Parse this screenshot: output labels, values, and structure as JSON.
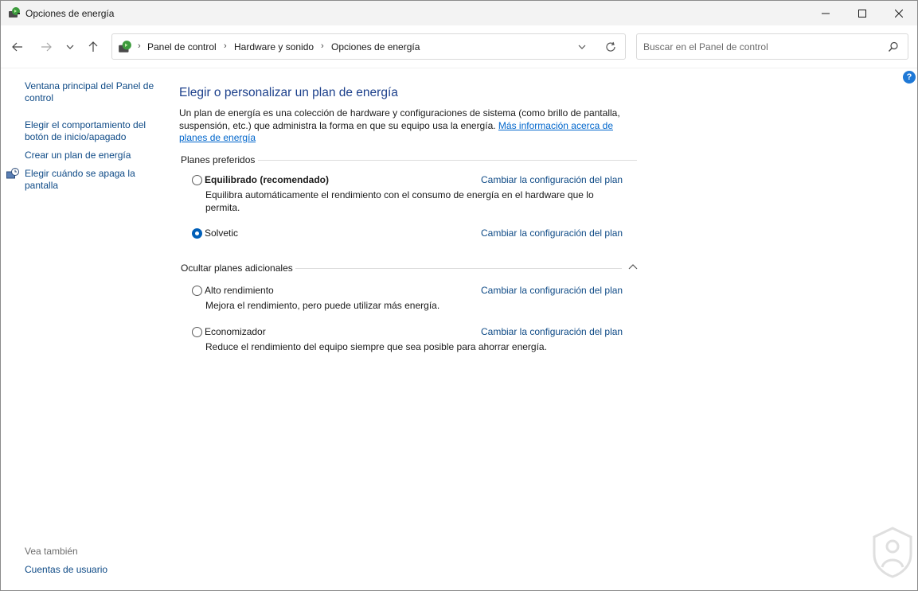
{
  "window": {
    "title": "Opciones de energía",
    "minimize_icon": "minimize-icon",
    "maximize_icon": "maximize-icon",
    "close_icon": "close-icon"
  },
  "navigation": {
    "breadcrumb": [
      "Panel de control",
      "Hardware y sonido",
      "Opciones de energía"
    ],
    "search_placeholder": "Buscar en el Panel de control"
  },
  "sidebar": {
    "links": [
      "Ventana principal del Panel de control",
      "Elegir el comportamiento del botón de inicio/apagado",
      "Crear un plan de energía",
      "Elegir cuándo se apaga la pantalla"
    ],
    "see_also_label": "Vea también",
    "see_also_link": "Cuentas de usuario"
  },
  "main": {
    "title": "Elegir o personalizar un plan de energía",
    "description": "Un plan de energía es una colección de hardware y configuraciones de sistema (como brillo de pantalla, suspensión, etc.) que administra la forma en que su equipo usa la energía.",
    "more_info_link": "Más información acerca de planes de energía",
    "preferred_header": "Planes preferidos",
    "additional_header": "Ocultar planes adicionales",
    "change_link": "Cambiar la configuración del plan",
    "plans": [
      {
        "name": "Equilibrado (recomendado)",
        "description": "Equilibra automáticamente el rendimiento con el consumo de energía en el hardware que lo permita.",
        "selected": false
      },
      {
        "name": "Solvetic",
        "description": "",
        "selected": true
      },
      {
        "name": "Alto rendimiento",
        "description": "Mejora el rendimiento, pero puede utilizar más energía.",
        "selected": false
      },
      {
        "name": "Economizador",
        "description": "Reduce el rendimiento del equipo siempre que sea posible para ahorrar energía.",
        "selected": false
      }
    ]
  },
  "help_label": "?",
  "colors": {
    "link": "#0e4a86",
    "title": "#1b3f8b",
    "accent": "#005fb8"
  }
}
